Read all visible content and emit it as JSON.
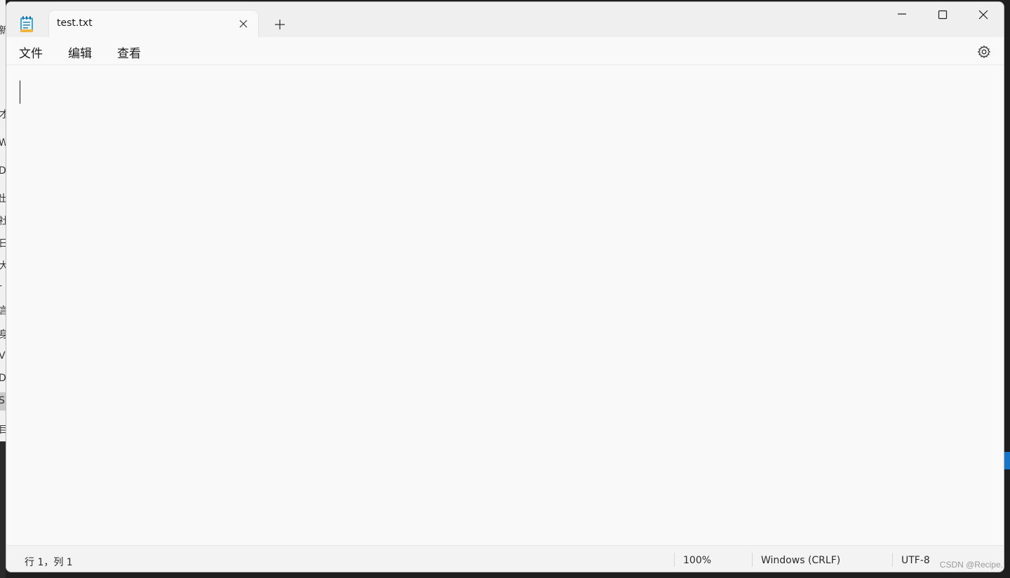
{
  "background": {
    "left_chars": [
      "新",
      "才",
      "W",
      "D",
      "出",
      "社",
      "日",
      "大",
      "-",
      "言",
      "身",
      "V",
      "D",
      "S",
      "目"
    ]
  },
  "window": {
    "tab": {
      "title": "test.txt"
    },
    "controls": {
      "new_tab": "+",
      "minimize": "minimize-icon",
      "maximize": "maximize-icon",
      "close": "close-icon"
    }
  },
  "menu": {
    "file": "文件",
    "edit": "编辑",
    "view": "查看"
  },
  "editor": {
    "content": ""
  },
  "status": {
    "position": "行 1，列 1",
    "zoom": "100%",
    "line_ending": "Windows (CRLF)",
    "encoding": "UTF-8"
  },
  "watermark": "CSDN @Recipe."
}
